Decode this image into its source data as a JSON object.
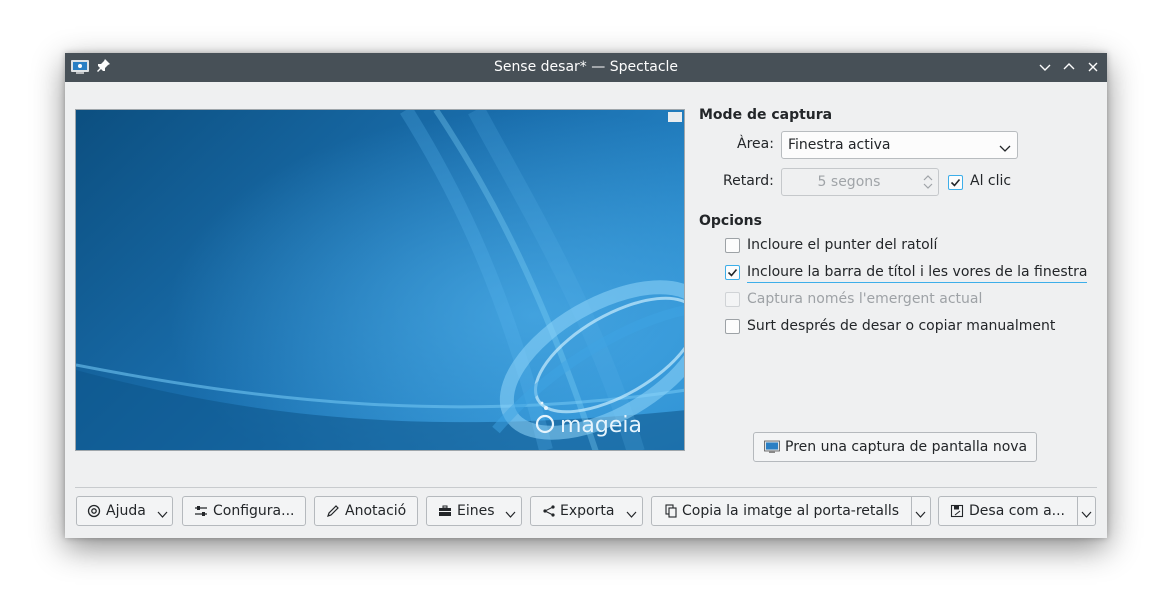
{
  "window": {
    "title": "Sense desar* — Spectacle"
  },
  "capture_mode": {
    "title": "Mode de captura",
    "area_label": "Àrea:",
    "area_value": "Finestra activa",
    "delay_label": "Retard:",
    "delay_value": "5 segons",
    "on_click_label": "Al clic",
    "on_click_checked": true
  },
  "options": {
    "title": "Opcions",
    "items": [
      {
        "label": "Incloure el punter del ratolí",
        "checked": false,
        "enabled": true
      },
      {
        "label": "Incloure la barra de títol i les vores de la finestra",
        "checked": true,
        "enabled": true
      },
      {
        "label": "Captura només l'emergent actual",
        "checked": false,
        "enabled": false
      },
      {
        "label": "Surt després de desar o copiar manualment",
        "checked": false,
        "enabled": true
      }
    ]
  },
  "new_capture_button": "Pren una captura de pantalla nova",
  "preview": {
    "logo_text": "mageia"
  },
  "toolbar": {
    "help": "Ajuda",
    "configure": "Configura...",
    "annotate": "Anotació",
    "tools": "Eines",
    "export": "Exporta",
    "copy": "Copia la imatge al porta-retalls",
    "save": "Desa com a..."
  },
  "colors": {
    "titlebar": "#475057",
    "window_bg": "#eff0f1",
    "accent": "#3daee9",
    "wallpaper_dark": "#0c4f80",
    "wallpaper_light": "#2a8dd0"
  }
}
